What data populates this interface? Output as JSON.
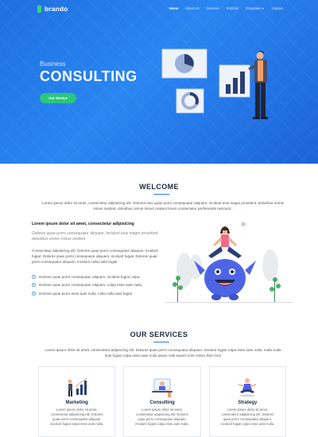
{
  "nav": {
    "brand": "brando",
    "items": [
      {
        "label": "Home",
        "active": true
      },
      {
        "label": "About Us",
        "active": false
      },
      {
        "label": "Services",
        "active": false
      },
      {
        "label": "Portfolio",
        "active": false
      },
      {
        "label": "Dropdown",
        "active": false,
        "has_caret": true
      },
      {
        "label": "Contact",
        "active": false
      }
    ]
  },
  "hero": {
    "subtitle": "Business",
    "title": "CONSULTING",
    "button_label": "Our Service",
    "colors": {
      "background": "#1e6fe0",
      "button": "#2bc77a"
    }
  },
  "welcome": {
    "title": "WELCOME",
    "intro": "Lorem ipsum dolor sit amet, consectetur adipisicing elit. Dolores eius quae porro consequatur aliquam, incidunt eius magni provident, doloribus omnis minus ovident, doloribus omnis minus ovident lorem consectetur perferendis nesciunt..",
    "heading": "Lorem ipsum dolor sit amet, consectetur adipisicing",
    "quote": "Dolores quae porro consequatur aliquam, incidunt eius magni provident, doloribus omnis minus ovident",
    "paragraph": "Consectetur adipisicing elit. Dolores quae porro consequatur aliquam, incidunt fugiat. Dolores quae porro consequatur aliquam, incidunt fugiat. Dolores quae porro consequatur aliquam, incidunt nulla nulla fugiat",
    "list": [
      "Dolores quae porro consequatur aliquam, incidunt fugiat culpa.",
      "Dolores quae porro consequatur aliquam, culpa esse aute nulla.",
      "Dolores quae porro esse aute nulla. nulla nulla duis fugiat"
    ]
  },
  "services": {
    "title": "OUR SERVICES",
    "intro": "Lorem ipsum dolor sit amet, consectetur adipisicing elit. Dolores quae porro consequatur aliquam, incidunt fugiat culpa esse aute nulla. malis nulla duis fugiat culpa esse aute nulla ipsum velit export irure minim illum fore",
    "cards": [
      {
        "title": "Marketing",
        "text": "Lorem ipsum dolor sit amet, consectetur adipisicing elit. Dolores quae porro consequatur aliquam, incidunt fugiat culpa esse aute nulla.",
        "icon": "marketing-chart-icon"
      },
      {
        "title": "Consulting",
        "text": "Lorem ipsum dolor sit amet, consectetur adipisicing elit. Dolores quae porro consequatur aliquam, incidunt fugiat culpa esse aute nulla.",
        "icon": "consulting-laptop-icon"
      },
      {
        "title": "Strategy",
        "text": "Lorem ipsum dolor sit amet, consectetur adipisicing elit. Dolores quae porro consequatur aliquam, incidunt fugiat culpa esse aute nulla.",
        "icon": "strategy-meditation-icon"
      }
    ]
  },
  "colors": {
    "accent": "#2a7ef0",
    "check": "#5b8def"
  }
}
